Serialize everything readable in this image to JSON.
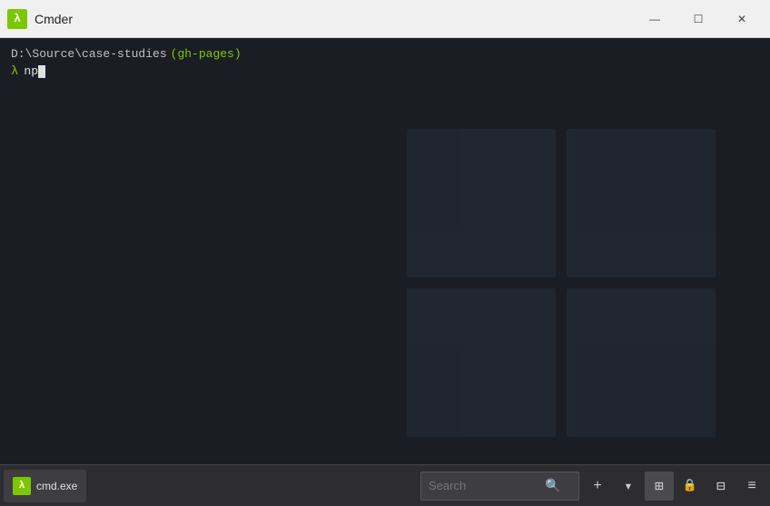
{
  "titleBar": {
    "appName": "Cmder",
    "appIconSymbol": "λ",
    "minimize": "—",
    "maximize": "☐",
    "close": "✕"
  },
  "terminal": {
    "path": "D:\\Source\\case-studies",
    "branch": "(gh-pages)",
    "promptSymbol": "λ",
    "command": "np"
  },
  "taskbar": {
    "tab": {
      "iconSymbol": "λ",
      "label": "cmd.exe"
    },
    "search": {
      "placeholder": "Search",
      "value": ""
    },
    "icons": {
      "plus": "+",
      "dropdown": "▾",
      "grid": "⊞",
      "lock": "🔒",
      "panels": "⊟",
      "menu": "≡"
    }
  }
}
